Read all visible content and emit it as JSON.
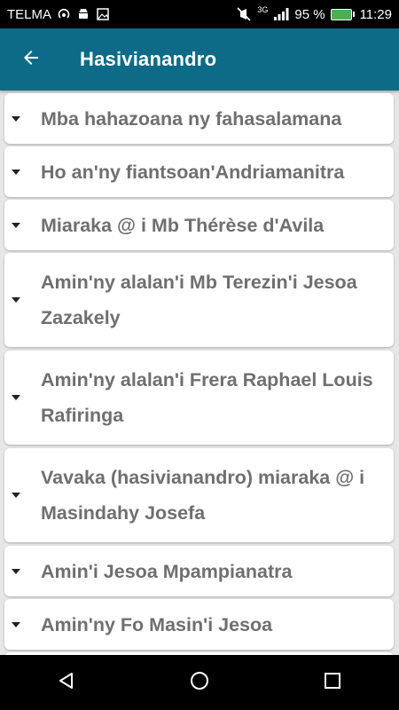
{
  "status_bar": {
    "carrier": "TELMA",
    "network": "3G",
    "battery_percent": "95 %",
    "time": "11:29"
  },
  "app_bar": {
    "title": "Hasivianandro"
  },
  "list": {
    "items": [
      {
        "label": "Mba hahazoana ny fahasalamana"
      },
      {
        "label": "Ho an'ny fiantsoan'Andriamanitra"
      },
      {
        "label": "Miaraka @ i Mb Thérèse d'Avila"
      },
      {
        "label": "Amin'ny alalan'i Mb Terezin'i Jesoa Zazakely"
      },
      {
        "label": "Amin'ny alalan'i Frera Raphael Louis Rafiringa"
      },
      {
        "label": "Vavaka (hasivianandro) miaraka @ i Masindahy Josefa"
      },
      {
        "label": "Amin'i Jesoa Mpampianatra"
      },
      {
        "label": "Amin'ny Fo Masin'i Jesoa"
      }
    ]
  },
  "colors": {
    "app_bar": "#0e6b87",
    "item_text": "#6f6f6f",
    "background": "#e6e6e6",
    "battery": "#4caf50"
  }
}
